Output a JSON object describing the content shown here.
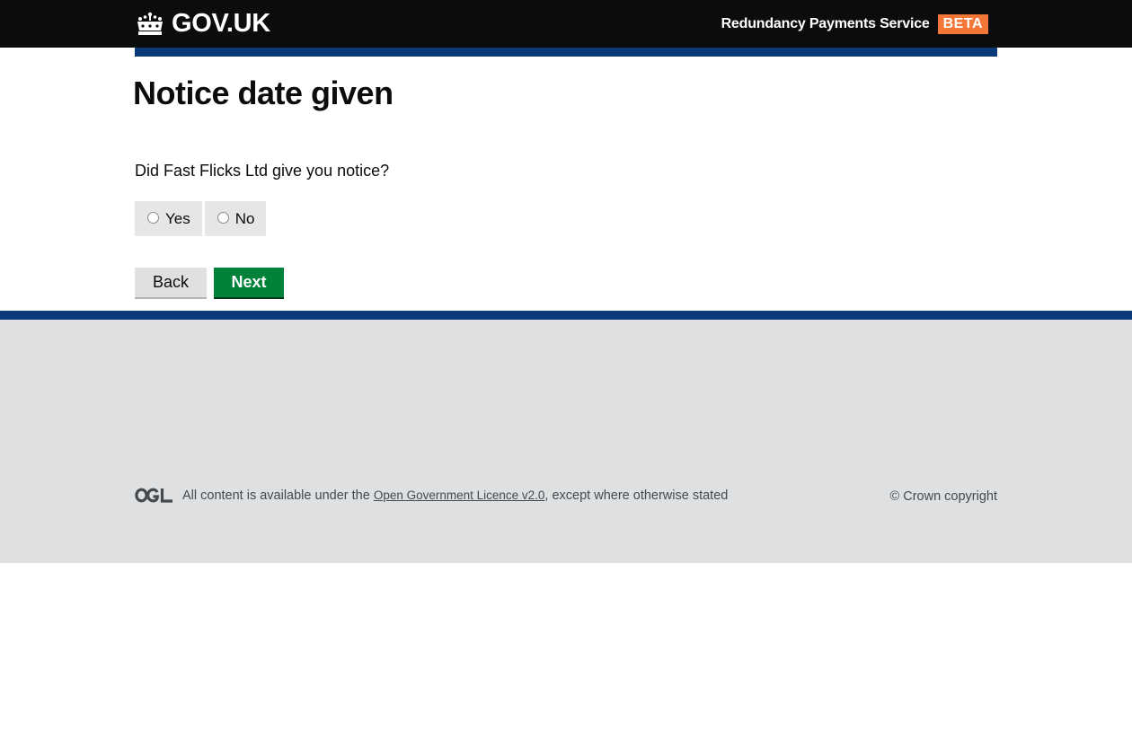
{
  "header": {
    "logo_text": "GOV.UK",
    "service_name": "Redundancy Payments Service",
    "phase_tag": "BETA"
  },
  "main": {
    "title": "Notice date given",
    "question": "Did Fast Flicks Ltd give you notice?",
    "options": [
      {
        "label": "Yes",
        "selected": false
      },
      {
        "label": "No",
        "selected": false
      }
    ],
    "back_label": "Back",
    "next_label": "Next"
  },
  "footer": {
    "licence_prefix": "All content is available under the ",
    "licence_link": "Open Government Licence v2.0",
    "licence_suffix": ", except where otherwise stated",
    "copyright": "© Crown copyright"
  },
  "colors": {
    "header_bg": "#0b0c0c",
    "blue_bar": "#0b3a7a",
    "phase_tag": "#f47738",
    "next_button": "#00823b",
    "footer_bg": "#dee0e2"
  },
  "icons": {
    "logo": "crown-icon",
    "licence": "ogl-logo-icon"
  }
}
